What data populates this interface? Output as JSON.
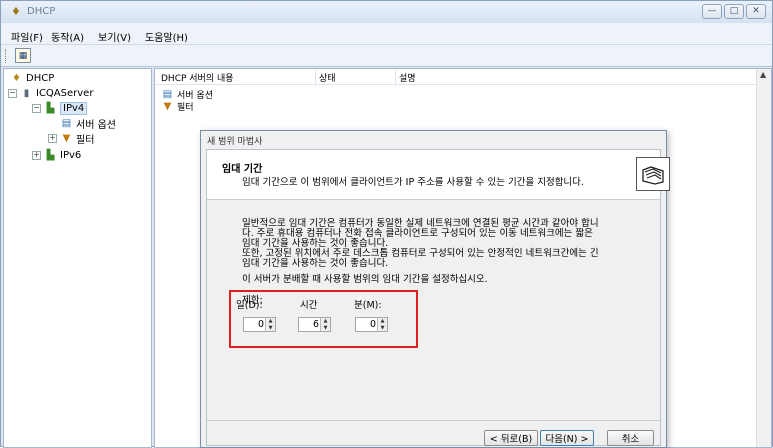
{
  "window": {
    "title": "DHCP",
    "controls": {
      "minimize": "—",
      "maximize": "□",
      "close": "✕"
    }
  },
  "menu": {
    "file": "파일(F)",
    "action": "동작(A)",
    "view": "보기(V)",
    "help": "도움말(H)"
  },
  "tree": {
    "root": "DHCP",
    "server": "ICQAServer",
    "ipv4": "IPv4",
    "server_options": "서버 옵션",
    "filters": "필터",
    "ipv6": "IPv6"
  },
  "content": {
    "columns": [
      "DHCP 서버의 내용",
      "상태",
      "설명"
    ],
    "rows": [
      "서버 옵션",
      "필터"
    ]
  },
  "wizard": {
    "title": "새 범위 마법사",
    "heading": "임대 기간",
    "subheading": "임대 기간으로 이 범위에서 클라이언트가 IP 주소를 사용할 수 있는 기간을 지정합니다.",
    "paragraph1_lines": [
      "일반적으로 임대 기간은 컴퓨터가 동일한 실제 네트워크에 연결된 평균 시간과 같아야 합니",
      "다. 주로 휴대용 컴퓨터나 전화 접속 클라이언트로 구성되어 있는 이동 네트워크에는 짧은",
      "임대 기간을 사용하는 것이 좋습니다."
    ],
    "paragraph2_lines": [
      "또한, 고정된 위치에서 주로 데스크톱 컴퓨터로 구성되어 있는 안정적인 네트워크간에는 긴",
      "임대 기간을 사용하는 것이 좋습니다."
    ],
    "instruction": "이 서버가 분배할 때 사용할 범위의 임대 기간을 설정하십시오.",
    "limit_label": "제한:",
    "days_label": "일(D):",
    "hours_label": "시간",
    "minutes_label": "분(M):",
    "days_value": "0",
    "hours_value": "6",
    "minutes_value": "0",
    "back_button": "< 뒤로(B)",
    "next_button": "다음(N) >",
    "cancel_button": "취소"
  }
}
